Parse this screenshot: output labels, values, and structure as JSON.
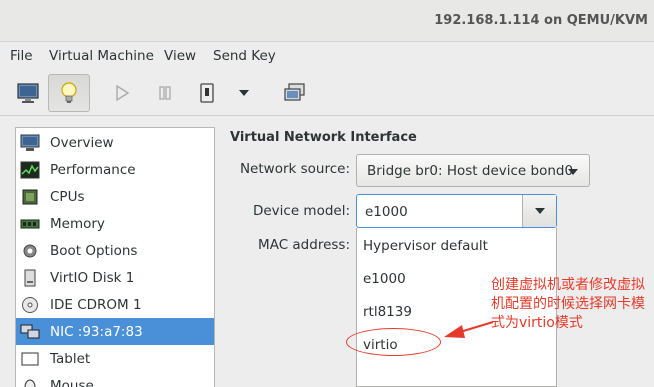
{
  "window": {
    "title": "192.168.1.114 on QEMU/KVM"
  },
  "menu": [
    "File",
    "Virtual Machine",
    "View",
    "Send Key"
  ],
  "toolbar": {
    "icons": [
      "monitor-icon",
      "lightbulb-icon",
      "play-icon",
      "pause-icon",
      "power-icon",
      "dropdown-arrow-icon",
      "screenshot-icon"
    ]
  },
  "sidebar": {
    "items": [
      {
        "label": "Overview",
        "icon": "monitor-icon"
      },
      {
        "label": "Performance",
        "icon": "performance-chart-icon"
      },
      {
        "label": "CPUs",
        "icon": "cpu-icon"
      },
      {
        "label": "Memory",
        "icon": "memory-icon"
      },
      {
        "label": "Boot Options",
        "icon": "gear-icon"
      },
      {
        "label": "VirtIO Disk 1",
        "icon": "disk-icon"
      },
      {
        "label": "IDE CDROM 1",
        "icon": "cdrom-icon"
      },
      {
        "label": "NIC :93:a7:83",
        "icon": "network-icon",
        "selected": true
      },
      {
        "label": "Tablet",
        "icon": "tablet-icon"
      },
      {
        "label": "Mouse",
        "icon": "mouse-icon"
      }
    ]
  },
  "panel": {
    "title": "Virtual Network Interface",
    "network_source_label": "Network source:",
    "network_source_value": "Bridge br0: Host device bond0",
    "device_model_label": "Device model:",
    "device_model_value": "e1000",
    "mac_label": "MAC address:",
    "options": [
      "Hypervisor default",
      "e1000",
      "rtl8139",
      "virtio"
    ]
  },
  "annotation": {
    "text": "创建虚拟机或者修改虚拟机配置的时候选择网卡模式为virtio模式",
    "color": "#e53a2a"
  },
  "colors": {
    "accent": "#4a90d9",
    "annotation": "#e53a2a"
  }
}
